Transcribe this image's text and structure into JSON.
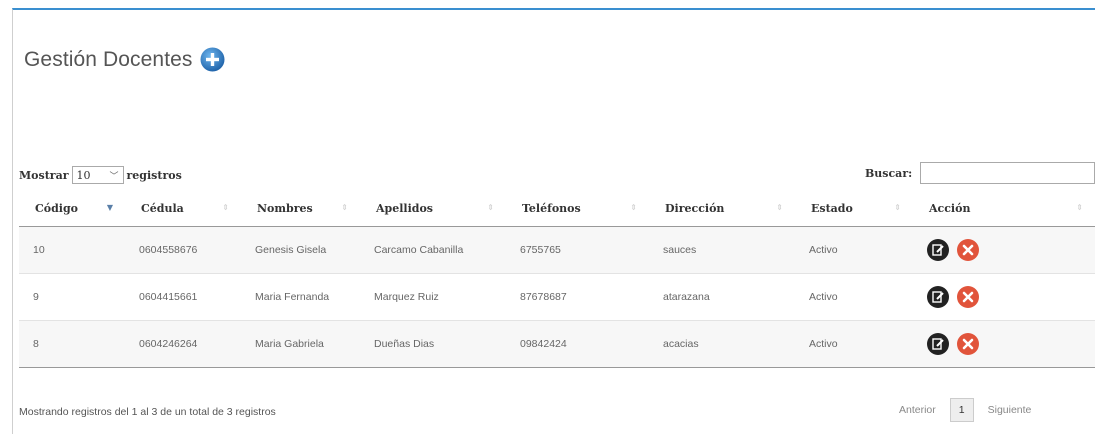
{
  "header": {
    "title": "Gestión Docentes",
    "add_icon": "plus-circle-icon"
  },
  "controls": {
    "show_label": "Mostrar",
    "page_size": "10",
    "records_label": "registros",
    "search_label": "Buscar:",
    "search_value": ""
  },
  "table": {
    "columns": [
      "Código",
      "Cédula",
      "Nombres",
      "Apellidos",
      "Teléfonos",
      "Dirección",
      "Estado",
      "Acción"
    ],
    "rows": [
      [
        "10",
        "0604558676",
        "Genesis Gisela",
        "Carcamo Cabanilla",
        "6755765",
        "sauces",
        "Activo"
      ],
      [
        "9",
        "0604415661",
        "Maria Fernanda",
        "Marquez Ruiz",
        "87678687",
        "atarazana",
        "Activo"
      ],
      [
        "8",
        "0604246264",
        "Maria Gabriela",
        "Dueñas Dias",
        "09842424",
        "acacias",
        "Activo"
      ]
    ],
    "action_icons": [
      "edit-icon",
      "delete-icon"
    ]
  },
  "footer": {
    "info": "Mostrando registros del 1 al 3 de un total de 3 registros",
    "prev": "Anterior",
    "page": "1",
    "next": "Siguiente"
  },
  "colors": {
    "accent": "#3a8fd0",
    "delete": "#e1543b",
    "edit": "#222222"
  }
}
